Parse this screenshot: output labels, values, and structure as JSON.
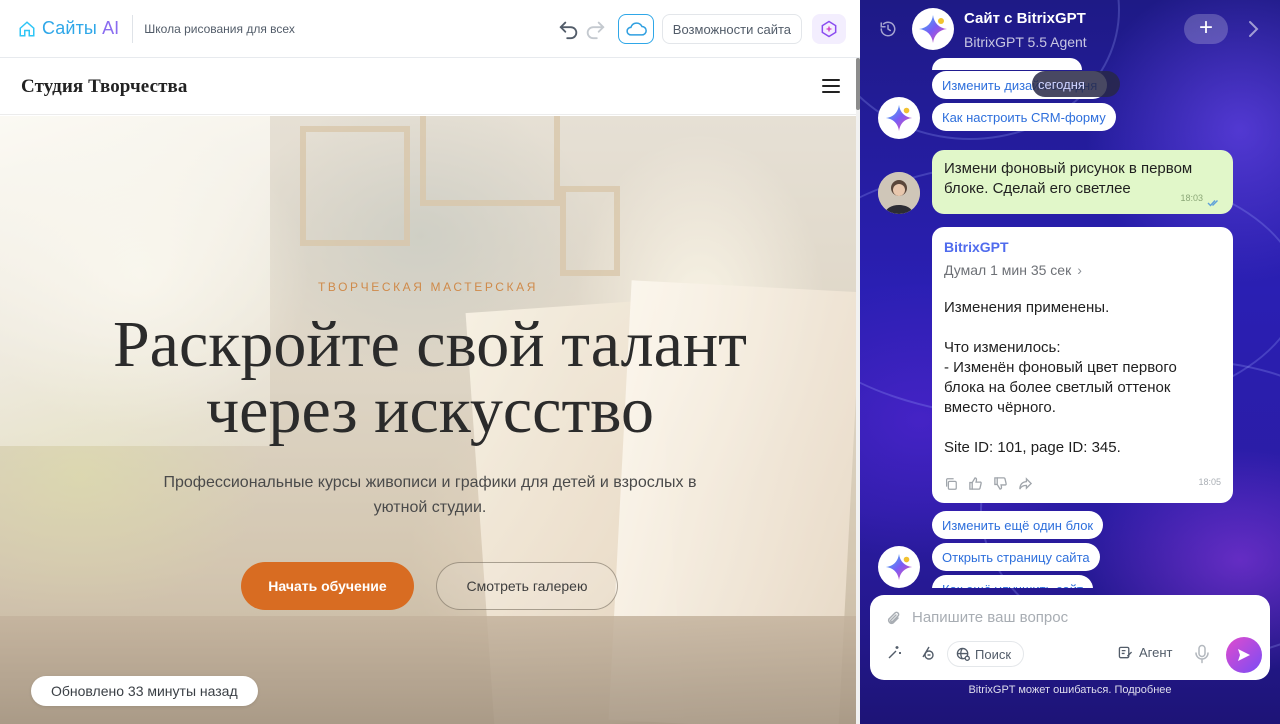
{
  "editor": {
    "brand_prefix": "Сайты",
    "brand_ai": "AI",
    "site_name": "Школа рисования для всех",
    "features_label": "Возможности сайта"
  },
  "site": {
    "logo": "Студия Творчества",
    "eyebrow": "ТВОРЧЕСКАЯ МАСТЕРСКАЯ",
    "headline_line1": "Раскройте свой талант",
    "headline_line2": "через искусство",
    "subtitle": "Профессиональные курсы живописи и графики для детей и взрослых в уютной студии.",
    "cta_primary": "Начать обучение",
    "cta_secondary": "Смотреть галерею",
    "updated": "Обновлено 33 минуты назад",
    "accent": "#d86c22"
  },
  "chat": {
    "title": "Сайт с BitrixGPT",
    "subtitle": "BitrixGPT 5.5 Agent",
    "chips_top": [
      "Изменить дизайн сегодня",
      "Как настроить CRM-форму"
    ],
    "chip_dark": "сегодня",
    "user_message": "Измени фоновый рисунок в первом блоке. Сделай его светлее",
    "user_time": "18:03",
    "bot_name": "BitrixGPT",
    "bot_thought": "Думал 1 мин 35 сек",
    "bot_text": "Изменения применены.\n\nЧто изменилось:\n- Изменён фоновый цвет первого блока на более светлый оттенок вместо чёрного.\n\nSite ID: 101, page ID: 345.",
    "bot_time": "18:05",
    "chips_bottom": [
      "Изменить ещё один блок",
      "Открыть страницу сайта",
      "Как ещё улучшить сайт"
    ],
    "composer_placeholder": "Напишите ваш вопрос",
    "search_label": "Поиск",
    "agent_label": "Агент",
    "disclaimer": "BitrixGPT может ошибаться. Подробнее",
    "accent": "#4f6bed",
    "user_bubble_color": "#e1f7c9"
  }
}
